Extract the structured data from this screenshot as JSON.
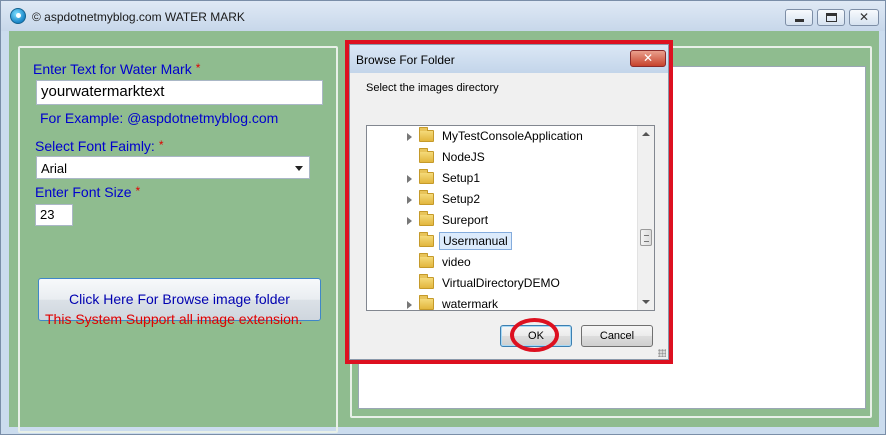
{
  "window": {
    "title": "© aspdotnetmyblog.com WATER MARK",
    "caption_buttons": {
      "minimize": "minimize",
      "maximize": "maximize",
      "close": "✕"
    }
  },
  "form": {
    "watermark_text_label": "Enter Text for Water Mark",
    "watermark_text_value": "yourwatermarktext",
    "example_label": "For Example:  @aspdotnetmyblog.com",
    "font_family_label": "Select Font Faimly:",
    "font_family_value": "Arial",
    "font_size_label": "Enter Font Size",
    "font_size_value": "23",
    "required_marker": "*",
    "browse_button_label": "Click Here For Browse image folder",
    "support_note": "This System Support all image extension."
  },
  "dialog": {
    "title": "Browse For Folder",
    "close_glyph": "✕",
    "description": "Select the images directory",
    "folders": [
      {
        "name": "MyTestConsoleApplication",
        "expandable": true,
        "selected": false
      },
      {
        "name": "NodeJS",
        "expandable": false,
        "selected": false
      },
      {
        "name": "Setup1",
        "expandable": true,
        "selected": false
      },
      {
        "name": "Setup2",
        "expandable": true,
        "selected": false
      },
      {
        "name": "Sureport",
        "expandable": true,
        "selected": false
      },
      {
        "name": "Usermanual",
        "expandable": false,
        "selected": true
      },
      {
        "name": "video",
        "expandable": false,
        "selected": false
      },
      {
        "name": "VirtualDirectoryDEMO",
        "expandable": false,
        "selected": false
      },
      {
        "name": "watermark",
        "expandable": true,
        "selected": false
      }
    ],
    "ok_label": "OK",
    "cancel_label": "Cancel"
  },
  "colors": {
    "client_background": "#8fbc8f",
    "label_text": "#0000cd",
    "required_and_note": "#e00000",
    "annotation_highlight": "#dd1020"
  }
}
